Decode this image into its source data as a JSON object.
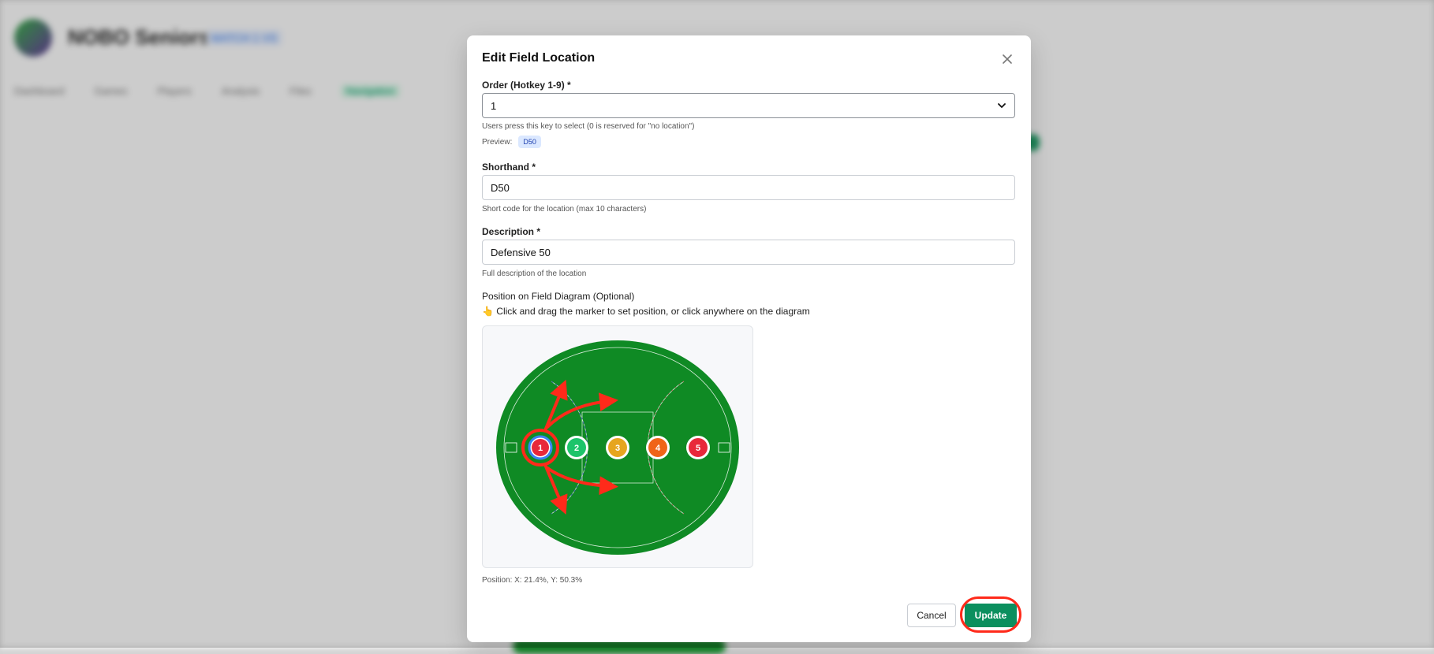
{
  "background": {
    "app_title": "NOBO Seniors",
    "app_tag": "MATCH 1 VS",
    "nav": [
      "Dashboard",
      "Games",
      "Players",
      "Analysis",
      "Files",
      "Navigation"
    ]
  },
  "modal": {
    "title": "Edit Field Location",
    "order": {
      "label": "Order (Hotkey 1-9) *",
      "value": "1",
      "hint": "Users press this key to select (0 is reserved for \"no location\")"
    },
    "preview": {
      "label": "Preview:",
      "badge": "D50"
    },
    "shorthand": {
      "label": "Shorthand *",
      "value": "D50",
      "hint": "Short code for the location (max 10 characters)"
    },
    "description": {
      "label": "Description *",
      "value": "Defensive 50",
      "hint": "Full description of the location"
    },
    "diagram": {
      "label": "Position on Field Diagram (Optional)",
      "instruction": "👆 Click and drag the marker to set position, or click anywhere on the diagram",
      "markers": [
        {
          "label": "1",
          "color": "#e8283a"
        },
        {
          "label": "2",
          "color": "#1dc46a"
        },
        {
          "label": "3",
          "color": "#e6a51f"
        },
        {
          "label": "4",
          "color": "#f06418"
        },
        {
          "label": "5",
          "color": "#e8283a"
        }
      ],
      "field_color": "#0f8a24",
      "annotation_color": "#ff2a1a"
    },
    "position_readout": "Position: X: 21.4%, Y: 50.3%",
    "buttons": {
      "cancel": "Cancel",
      "update": "Update"
    }
  }
}
